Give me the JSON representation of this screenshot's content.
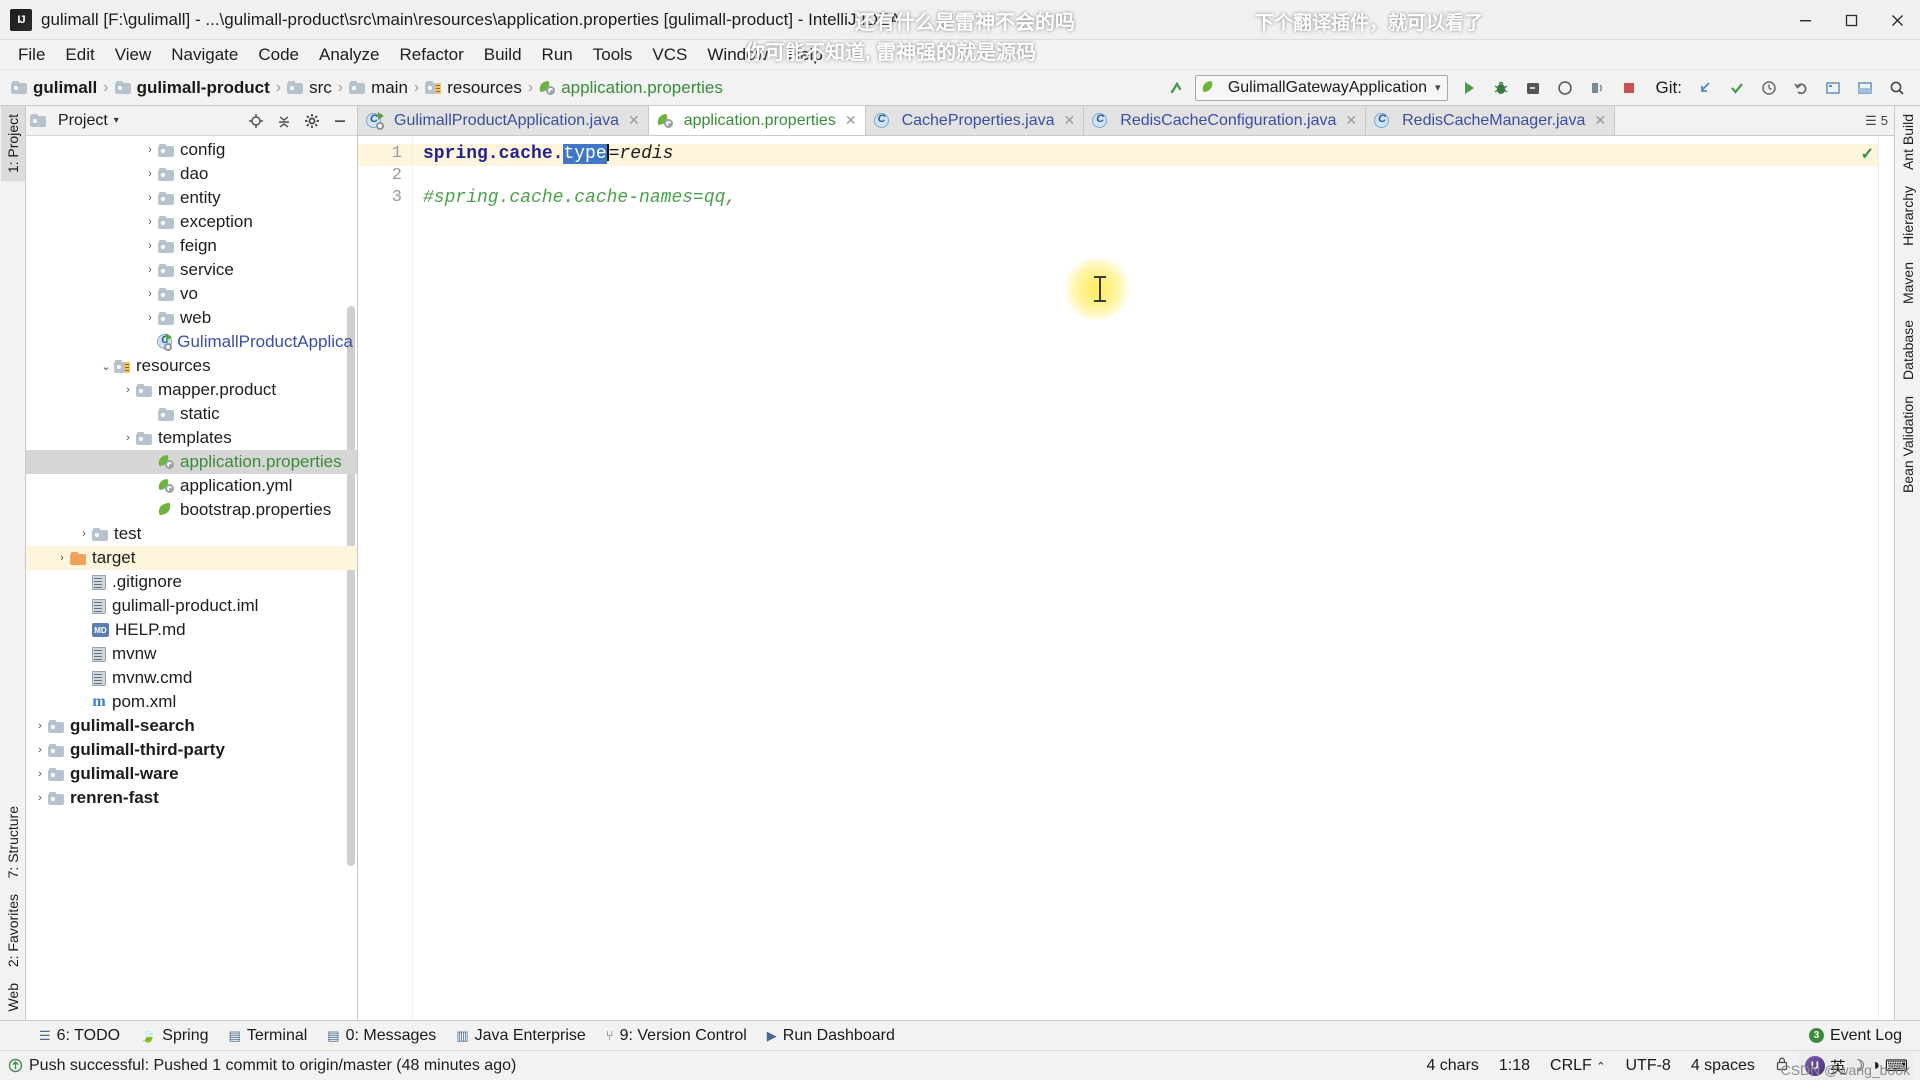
{
  "window": {
    "title": "gulimall [F:\\gulimall] - ...\\gulimall-product\\src\\main\\resources\\application.properties [gulimall-product] - IntelliJ IDEA",
    "app_icon": "intellij-idea-icon",
    "minimize": "–",
    "maximize": "▢",
    "close": "✕"
  },
  "overlay": {
    "line1": "还有什么是雷神不会的吗",
    "line2": "你可能不知道, 雷神强的就是源码",
    "line3": "下个翻译插件，就可以看了",
    "csdn": "CSDN @wang_book"
  },
  "menubar": {
    "items": [
      {
        "label": "File"
      },
      {
        "label": "Edit"
      },
      {
        "label": "View"
      },
      {
        "label": "Navigate"
      },
      {
        "label": "Code"
      },
      {
        "label": "Analyze"
      },
      {
        "label": "Refactor"
      },
      {
        "label": "Build"
      },
      {
        "label": "Run"
      },
      {
        "label": "Tools"
      },
      {
        "label": "VCS"
      },
      {
        "label": "Window"
      },
      {
        "label": "Help"
      }
    ]
  },
  "breadcrumb": {
    "items": [
      {
        "label": "gulimall",
        "icon": "module-folder-icon",
        "bold": true
      },
      {
        "label": "gulimall-product",
        "icon": "module-folder-icon",
        "bold": true
      },
      {
        "label": "src",
        "icon": "folder-icon",
        "bold": false
      },
      {
        "label": "main",
        "icon": "folder-icon",
        "bold": false
      },
      {
        "label": "resources",
        "icon": "resources-folder-icon",
        "bold": false
      },
      {
        "label": "application.properties",
        "icon": "spring-properties-icon",
        "bold": false
      }
    ]
  },
  "toolbar": {
    "run_config": "GulimallGatewayApplication",
    "git_label": "Git:",
    "buttons": [
      {
        "name": "run-button",
        "glyph": "▶"
      },
      {
        "name": "debug-button",
        "glyph": "🐞"
      },
      {
        "name": "run-with-coverage-button",
        "glyph": "▣"
      },
      {
        "name": "profile-button",
        "glyph": "◔"
      },
      {
        "name": "attach-button",
        "glyph": "▤"
      },
      {
        "name": "stop-button",
        "glyph": "■"
      }
    ],
    "git_buttons": [
      {
        "name": "update-project-button",
        "glyph": "↙"
      },
      {
        "name": "commit-button",
        "glyph": "✓"
      },
      {
        "name": "history-button",
        "glyph": "◔"
      },
      {
        "name": "rollback-button",
        "glyph": "↺"
      }
    ],
    "right_buttons": [
      {
        "name": "settings-button",
        "glyph": "▦"
      },
      {
        "name": "select-in-button",
        "glyph": "⬓"
      },
      {
        "name": "search-everywhere-button",
        "glyph": "🔍"
      }
    ]
  },
  "project_panel": {
    "title": "Project",
    "header_buttons": [
      {
        "name": "scroll-from-source-button",
        "glyph": "⊕"
      },
      {
        "name": "collapse-all-button",
        "glyph": "⇅"
      },
      {
        "name": "settings-gear-button",
        "glyph": "⚙"
      },
      {
        "name": "hide-panel-button",
        "glyph": "—"
      }
    ],
    "tree": [
      {
        "label": "config",
        "indent": 5,
        "arrow": "closed",
        "icon": "folder-icon",
        "style": "plain"
      },
      {
        "label": "dao",
        "indent": 5,
        "arrow": "closed",
        "icon": "folder-icon",
        "style": "plain"
      },
      {
        "label": "entity",
        "indent": 5,
        "arrow": "closed",
        "icon": "folder-icon",
        "style": "plain"
      },
      {
        "label": "exception",
        "indent": 5,
        "arrow": "closed",
        "icon": "folder-icon",
        "style": "plain"
      },
      {
        "label": "feign",
        "indent": 5,
        "arrow": "closed",
        "icon": "folder-icon",
        "style": "plain"
      },
      {
        "label": "service",
        "indent": 5,
        "arrow": "closed",
        "icon": "folder-icon",
        "style": "plain"
      },
      {
        "label": "vo",
        "indent": 5,
        "arrow": "closed",
        "icon": "folder-icon",
        "style": "plain"
      },
      {
        "label": "web",
        "indent": 5,
        "arrow": "closed",
        "icon": "folder-icon",
        "style": "plain"
      },
      {
        "label": "GulimallProductApplica",
        "indent": 6,
        "arrow": "none",
        "icon": "spring-class-icon",
        "style": "blue"
      },
      {
        "label": "resources",
        "indent": 3,
        "arrow": "open",
        "icon": "resources-folder-icon",
        "style": "plain"
      },
      {
        "label": "mapper.product",
        "indent": 4,
        "arrow": "closed",
        "icon": "folder-icon",
        "style": "plain"
      },
      {
        "label": "static",
        "indent": 5,
        "arrow": "none",
        "icon": "folder-icon",
        "style": "plain"
      },
      {
        "label": "templates",
        "indent": 4,
        "arrow": "closed",
        "icon": "folder-icon",
        "style": "plain"
      },
      {
        "label": "application.properties",
        "indent": 5,
        "arrow": "none",
        "icon": "spring-properties-icon",
        "style": "green",
        "state": "selected"
      },
      {
        "label": "application.yml",
        "indent": 5,
        "arrow": "none",
        "icon": "spring-properties-icon",
        "style": "plain"
      },
      {
        "label": "bootstrap.properties",
        "indent": 5,
        "arrow": "none",
        "icon": "spring-boot-icon",
        "style": "plain"
      },
      {
        "label": "test",
        "indent": 2,
        "arrow": "closed",
        "icon": "folder-icon",
        "style": "plain"
      },
      {
        "label": "target",
        "indent": 1,
        "arrow": "closed",
        "icon": "target-folder-icon",
        "style": "plain",
        "state": "highlight"
      },
      {
        "label": ".gitignore",
        "indent": 2,
        "arrow": "none",
        "icon": "file-icon",
        "style": "plain"
      },
      {
        "label": "gulimall-product.iml",
        "indent": 2,
        "arrow": "none",
        "icon": "file-icon",
        "style": "plain"
      },
      {
        "label": "HELP.md",
        "indent": 2,
        "arrow": "none",
        "icon": "markdown-icon",
        "style": "plain"
      },
      {
        "label": "mvnw",
        "indent": 2,
        "arrow": "none",
        "icon": "file-icon",
        "style": "plain"
      },
      {
        "label": "mvnw.cmd",
        "indent": 2,
        "arrow": "none",
        "icon": "file-icon",
        "style": "plain"
      },
      {
        "label": "pom.xml",
        "indent": 2,
        "arrow": "none",
        "icon": "maven-icon",
        "style": "plain"
      },
      {
        "label": "gulimall-search",
        "indent": 0,
        "arrow": "closed",
        "icon": "module-folder-icon",
        "style": "bold"
      },
      {
        "label": "gulimall-third-party",
        "indent": 0,
        "arrow": "closed",
        "icon": "module-folder-icon",
        "style": "bold"
      },
      {
        "label": "gulimall-ware",
        "indent": 0,
        "arrow": "closed",
        "icon": "module-folder-icon",
        "style": "bold"
      },
      {
        "label": "renren-fast",
        "indent": 0,
        "arrow": "closed",
        "icon": "module-folder-icon",
        "style": "bold"
      }
    ]
  },
  "left_rail": {
    "tabs": [
      {
        "label": "1: Project",
        "state": "selected"
      },
      {
        "label": "7: Structure",
        "state": "normal"
      },
      {
        "label": "2: Favorites",
        "state": "normal"
      },
      {
        "label": "Web",
        "state": "normal"
      }
    ]
  },
  "right_rail": {
    "tabs": [
      {
        "label": "Ant Build"
      },
      {
        "label": "Hierarchy"
      },
      {
        "label": "Maven"
      },
      {
        "label": "Database"
      },
      {
        "label": "Bean Validation"
      }
    ]
  },
  "editor": {
    "tabs": [
      {
        "label": "GulimallProductApplication.java",
        "icon": "spring-class-icon",
        "state": "inactive"
      },
      {
        "label": "application.properties",
        "icon": "spring-properties-icon",
        "state": "active"
      },
      {
        "label": "CacheProperties.java",
        "icon": "java-class-icon",
        "state": "inactive"
      },
      {
        "label": "RedisCacheConfiguration.java",
        "icon": "java-class-icon",
        "state": "inactive"
      },
      {
        "label": "RedisCacheManager.java",
        "icon": "java-class-icon",
        "state": "inactive"
      }
    ],
    "tab_overflow": "5",
    "line_numbers": [
      "1",
      "2",
      "3"
    ],
    "lines": [
      {
        "n": 1,
        "key": "spring.cache.",
        "selected": "type",
        "eq": "=",
        "value": "redis",
        "comment": ""
      },
      {
        "n": 2,
        "key": "",
        "selected": "",
        "eq": "",
        "value": "",
        "comment": ""
      },
      {
        "n": 3,
        "key": "",
        "selected": "",
        "eq": "",
        "value": "",
        "comment": "#spring.cache.cache-names=qq,"
      }
    ],
    "inspection_status": "✓"
  },
  "tool_window_bar": {
    "items": [
      {
        "label": "6: TODO",
        "icon": "todo-icon"
      },
      {
        "label": "Spring",
        "icon": "spring-icon"
      },
      {
        "label": "Terminal",
        "icon": "terminal-icon"
      },
      {
        "label": "0: Messages",
        "icon": "messages-icon"
      },
      {
        "label": "Java Enterprise",
        "icon": "java-enterprise-icon"
      },
      {
        "label": "9: Version Control",
        "icon": "version-control-icon"
      },
      {
        "label": "Run Dashboard",
        "icon": "run-dashboard-icon"
      }
    ],
    "event_log": {
      "label": "Event Log",
      "badge": "3"
    }
  },
  "status_bar": {
    "message": "Push successful: Pushed 1 commit to origin/master (48 minutes ago)",
    "chars": "4 chars",
    "caret": "1:18",
    "line_sep": "CRLF",
    "encoding": "UTF-8",
    "indent": "4 spaces",
    "ime_lang": "英",
    "lock": "🔒"
  },
  "colors": {
    "accent_green": "#3a8c3a",
    "selection_blue": "#3f78c6",
    "highlight_yellow": "#fdf6dc",
    "key_blue": "#22228f",
    "tab_active": "#ffffff"
  }
}
